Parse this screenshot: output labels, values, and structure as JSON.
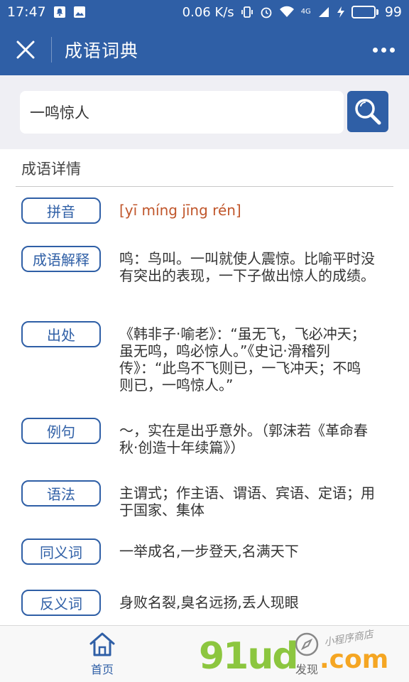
{
  "status_bar": {
    "time": "17:47",
    "network_speed": "0.06 K/s",
    "signal_type": "4G",
    "battery": "99",
    "battery_level": 0.99
  },
  "nav": {
    "title": "成语词典"
  },
  "search": {
    "value": "一鸣惊人"
  },
  "section": {
    "title": "成语详情"
  },
  "details": [
    {
      "label": "拼音",
      "value": "[yī míng jīng rén]"
    },
    {
      "label": "成语解释",
      "value": "鸣：鸟叫。一叫就使人震惊。比喻平时没有突出的表现，一下子做出惊人的成绩。"
    },
    {
      "label": "出处",
      "value": "《韩非子·喻老》：“虽无飞，飞必冲天；虽无鸣，鸣必惊人。”《史记·滑稽列传》：“此鸟不飞则已，一飞冲天；不鸣则已，一鸣惊人。”"
    },
    {
      "label": "例句",
      "value": "～，实在是出乎意外。（郭沫若《革命春秋·创造十年续篇》）"
    },
    {
      "label": "语法",
      "value": "主谓式；作主语、谓语、宾语、定语；用于国家、集体"
    },
    {
      "label": "同义词",
      "value": "一举成名,一步登天,名满天下"
    },
    {
      "label": "反义词",
      "value": "身败名裂,臭名远扬,丢人现眼"
    }
  ],
  "tabs": [
    {
      "label": "首页",
      "icon": "home-icon"
    },
    {
      "label": "发现",
      "icon": "compass-icon"
    }
  ],
  "watermark": {
    "main": "91ud",
    "suffix": ".com",
    "subtitle": "小程序商店"
  },
  "colors": {
    "primary": "#2f5fa6",
    "pinyin": "#c0562b",
    "search_bg": "#efeff4"
  }
}
